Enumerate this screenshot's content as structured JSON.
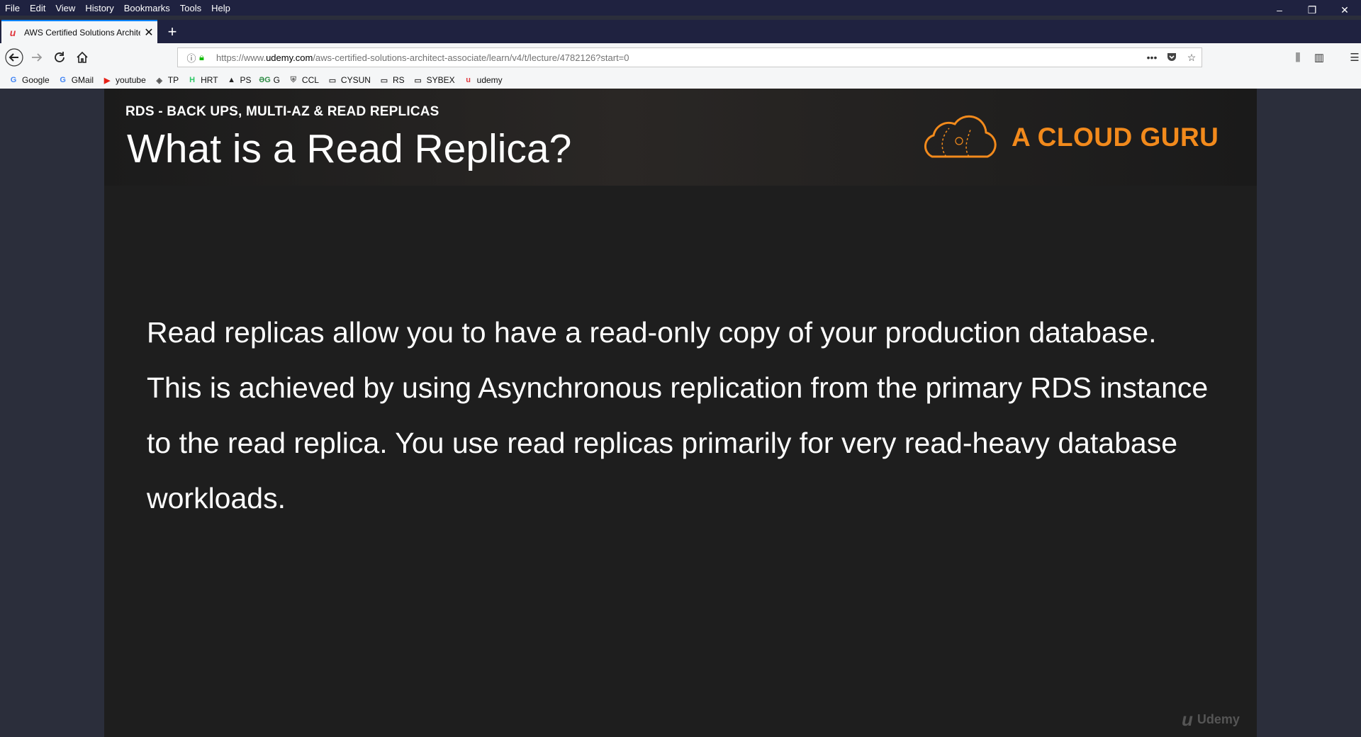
{
  "menu": [
    "File",
    "Edit",
    "View",
    "History",
    "Bookmarks",
    "Tools",
    "Help"
  ],
  "window_controls": {
    "minimize": "–",
    "restore": "❐",
    "close": "✕"
  },
  "tab": {
    "title": "AWS Certified Solutions Archite",
    "favicon": "udemy-icon",
    "close": "✕"
  },
  "new_tab": "+",
  "url": {
    "prefix": "https://www.",
    "domain": "udemy.com",
    "path": "/aws-certified-solutions-architect-associate/learn/v4/t/lecture/4782126?start=0"
  },
  "bookmarks": [
    {
      "label": "Google",
      "icon": "google-icon",
      "glyph": "G",
      "color": "#4285f4"
    },
    {
      "label": "GMail",
      "icon": "google-icon",
      "glyph": "G",
      "color": "#4285f4"
    },
    {
      "label": "youtube",
      "icon": "youtube-icon",
      "glyph": "▶",
      "color": "#e62117"
    },
    {
      "label": "TP",
      "icon": "tp-icon",
      "glyph": "◈",
      "color": "#555555"
    },
    {
      "label": "HRT",
      "icon": "hackerrank-icon",
      "glyph": "H",
      "color": "#2ec866"
    },
    {
      "label": "PS",
      "icon": "ps-icon",
      "glyph": "▲",
      "color": "#222222"
    },
    {
      "label": "G",
      "icon": "gfg-icon",
      "glyph": "ƏG",
      "color": "#2f8d46"
    },
    {
      "label": "CCL",
      "icon": "shield-icon",
      "glyph": "⛨",
      "color": "#666666"
    },
    {
      "label": "CYSUN",
      "icon": "folder-icon",
      "glyph": "▭",
      "color": "#444444"
    },
    {
      "label": "RS",
      "icon": "folder-icon",
      "glyph": "▭",
      "color": "#444444"
    },
    {
      "label": "SYBEX",
      "icon": "folder-icon",
      "glyph": "▭",
      "color": "#444444"
    },
    {
      "label": "udemy",
      "icon": "udemy-icon",
      "glyph": "u",
      "color": "#e0383e"
    }
  ],
  "slide": {
    "kicker": "RDS - BACK UPS, MULTI-AZ & READ REPLICAS",
    "title": "What is a Read Replica?",
    "brand": "A CLOUD GURU",
    "body": "Read replicas allow you to have a read-only copy of your production database. This is achieved by using Asynchronous replication from the primary RDS instance to the read replica. You use read replicas primarily for very read-heavy database workloads.",
    "watermark": "Udemy"
  },
  "colors": {
    "brand_orange": "#f28a1c",
    "chrome_dark": "#1f2240",
    "page_bg": "#2b2e3b"
  }
}
